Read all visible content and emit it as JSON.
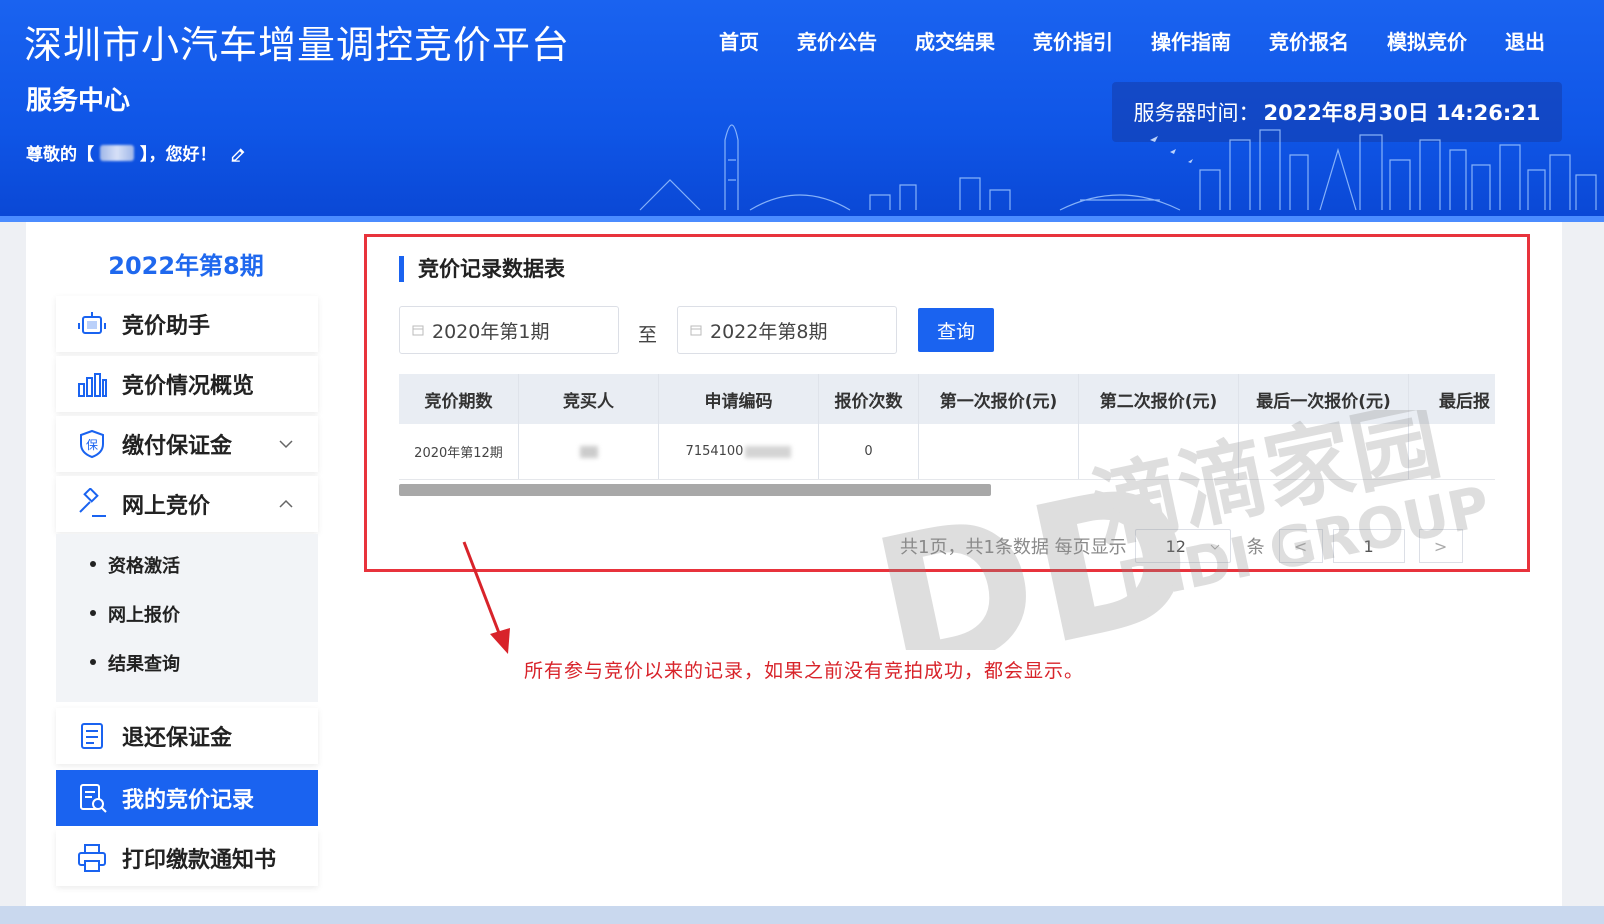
{
  "header": {
    "title": "深圳市小汽车增量调控竞价平台",
    "service_center": "服务中心",
    "greeting_prefix": "尊敬的【",
    "greeting_suffix": "】，您好！",
    "server_time_label": "服务器时间：",
    "server_time_value": "2022年8月30日 14:26:21",
    "nav": [
      "首页",
      "竞价公告",
      "成交结果",
      "竞价指引",
      "操作指南",
      "竞价报名",
      "模拟竞价",
      "退出"
    ]
  },
  "sidebar": {
    "period": "2022年第8期",
    "items": [
      {
        "label": "竞价助手",
        "icon": "robot-icon"
      },
      {
        "label": "竞价情况概览",
        "icon": "bar-chart-icon"
      },
      {
        "label": "缴付保证金",
        "icon": "shield-icon"
      },
      {
        "label": "网上竞价",
        "icon": "gavel-icon"
      },
      {
        "label": "退还保证金",
        "icon": "document-icon"
      },
      {
        "label": "我的竞价记录",
        "icon": "record-search-icon"
      },
      {
        "label": "打印缴款通知书",
        "icon": "printer-icon"
      }
    ],
    "subitems": [
      "资格激活",
      "网上报价",
      "结果查询"
    ],
    "shield_glyph": "保",
    "active_color": "#1a63f0"
  },
  "content": {
    "section_title": "竞价记录数据表",
    "start_period": "2020年第1期",
    "to_label": "至",
    "end_period": "2022年第8期",
    "query_label": "查询",
    "table": {
      "headers": [
        "竞价期数",
        "竞买人",
        "申请编码",
        "报价次数",
        "第一次报价(元)",
        "第二次报价(元)",
        "最后一次报价(元)",
        "最后报"
      ],
      "row": {
        "period": "2020年第12期",
        "code_prefix": "7154100",
        "count": "0"
      }
    },
    "pagination": {
      "summary": "共1页，共1条数据 每页显示",
      "page_size": "12",
      "unit": "条",
      "prev": "<",
      "current_page": "1",
      "next": ">"
    }
  },
  "annotation": {
    "text": "所有参与竞价以来的记录，如果之前没有竞拍成功，都会显示。",
    "color": "#d8232a"
  },
  "watermark": {
    "line1": "滴滴家园",
    "line2": "DD",
    "line3": "DIDI GROUP"
  }
}
